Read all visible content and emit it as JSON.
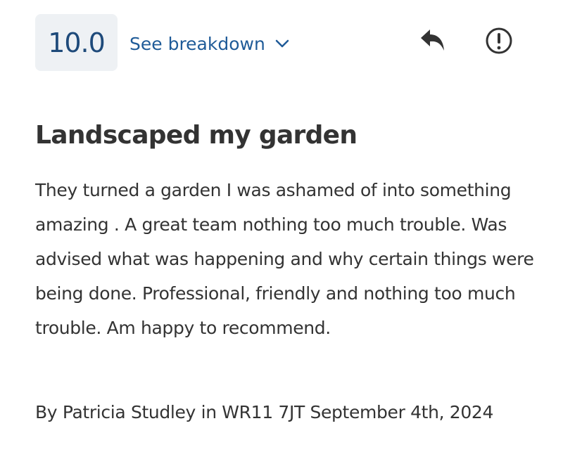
{
  "review": {
    "score": "10.0",
    "breakdown_label": "See breakdown",
    "title": "Landscaped my garden",
    "body": "They turned a garden I was ashamed of into something amazing . A great team nothing too much trouble. Was advised what was happening and why certain things were being done. Professional, friendly and nothing too much trouble. Am happy to recommend.",
    "meta": "By Patricia Studley in WR11 7JT September 4th, 2024"
  },
  "icons": {
    "breakdown_chevron": "chevron-down-icon",
    "reply": "reply-icon",
    "report": "report-icon"
  },
  "colors": {
    "score_bg": "#eef1f4",
    "score_text": "#1e4a7a",
    "link": "#1f5b98",
    "text": "#333333"
  }
}
